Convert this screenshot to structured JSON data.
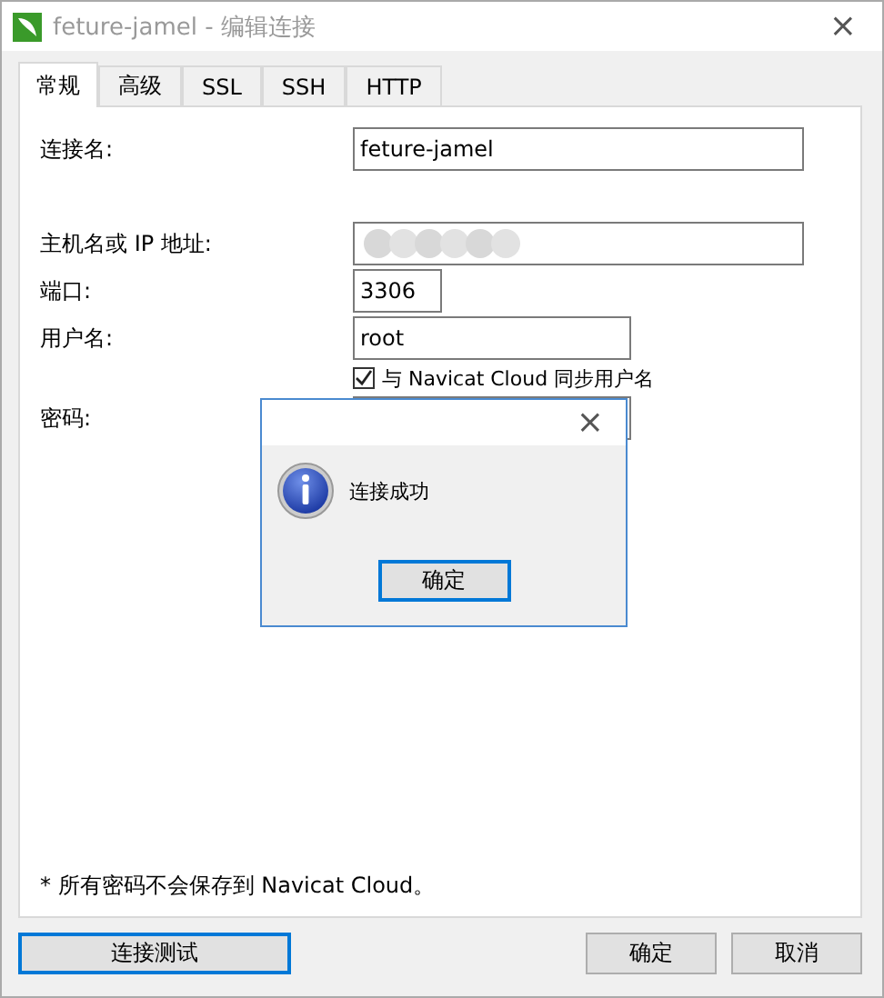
{
  "window": {
    "title": "feture-jamel - 编辑连接",
    "close": "×"
  },
  "tabs": [
    {
      "label": "常规",
      "selected": true
    },
    {
      "label": "高级",
      "selected": false
    },
    {
      "label": "SSL",
      "selected": false
    },
    {
      "label": "SSH",
      "selected": false
    },
    {
      "label": "HTTP",
      "selected": false
    }
  ],
  "form": {
    "fields": [
      {
        "kind": "text",
        "label": "连接名:",
        "value": "feture-jamel"
      },
      {
        "kind": "blurred",
        "label": "主机名或 IP 地址:"
      },
      {
        "kind": "text",
        "label": "端口:",
        "value": "3306"
      },
      {
        "kind": "text",
        "label": "用户名:",
        "value": "root"
      },
      {
        "kind": "checkbox",
        "label": "与 Navicat Cloud 同步用户名",
        "checked": true
      },
      {
        "kind": "password",
        "label": "密码:"
      }
    ]
  },
  "note": "* 所有密码不会保存到 Navicat Cloud。",
  "buttons": {
    "test": "连接测试",
    "ok": "确定",
    "cancel": "取消"
  },
  "message_box": {
    "close": "×",
    "message": "连接成功",
    "button": "确定"
  }
}
